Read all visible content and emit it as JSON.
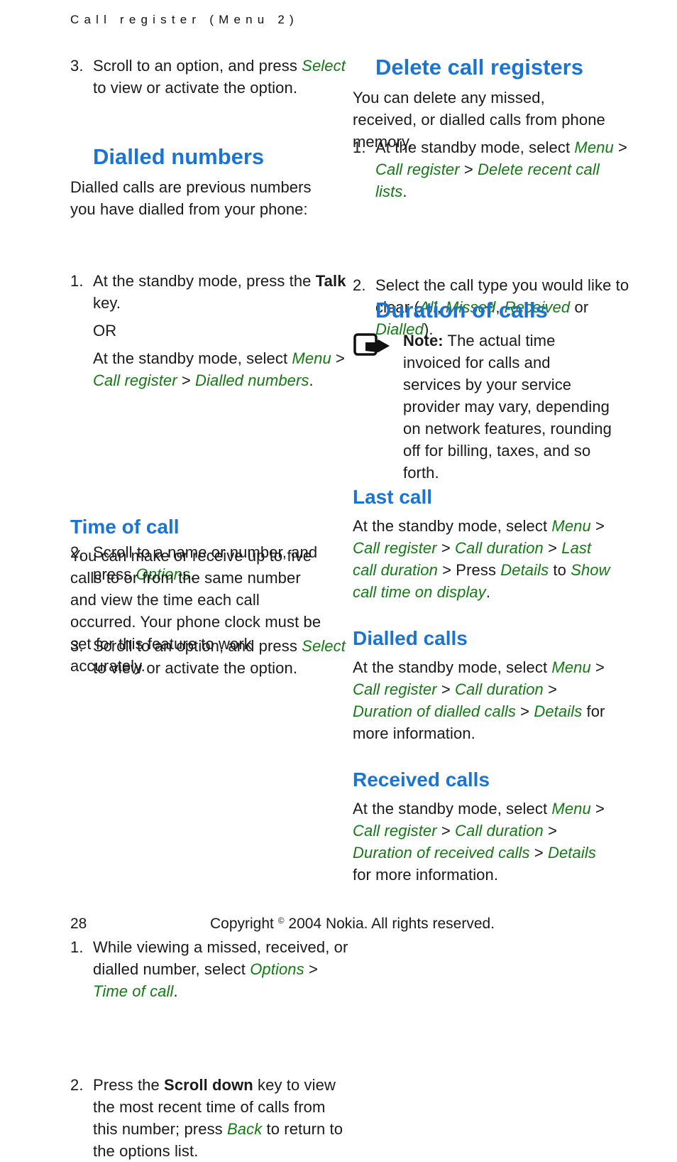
{
  "running_head": "Call register (Menu 2)",
  "left": {
    "step3_top": {
      "num": "3.",
      "pre": "Scroll to an option, and press ",
      "g1": "Select",
      "post": " to view or activate the option."
    },
    "dialled_numbers": {
      "heading": "Dialled numbers",
      "intro": "Dialled calls are previous numbers you have dialled from your phone:",
      "step1": {
        "num": "1.",
        "pre": "At the standby mode, press the ",
        "bold": "Talk",
        "post": " key."
      },
      "or": "OR",
      "alt": {
        "pre": "At the standby mode, select ",
        "g1": "Menu",
        "sep1": " > ",
        "g2": "Call register",
        "sep2": " > ",
        "g3": "Dialled numbers",
        "post": "."
      },
      "step2": {
        "num": "2.",
        "pre": "Scroll to a name or number, and press ",
        "g1": "Options",
        "post": "."
      },
      "step3": {
        "num": "3.",
        "pre": "Scroll to an option, and press ",
        "g1": "Select",
        "post": " to view or activate the option."
      }
    },
    "time_of_call": {
      "heading": "Time of call",
      "intro": "You can make or receive up to five calls to or from the same number and view the time each call occurred. Your phone clock must be set for this feature to work accurately.",
      "step1": {
        "num": "1.",
        "pre": "While viewing a missed, received, or dialled number, select ",
        "g1": "Options",
        "sep1": " > ",
        "g2": "Time of call",
        "post": "."
      },
      "step2": {
        "num": "2.",
        "pre": "Press the ",
        "bold": "Scroll down",
        "mid": " key to view the most recent time of calls from this number; press ",
        "g1": "Back",
        "post": " to return to the options list."
      }
    }
  },
  "right": {
    "delete": {
      "heading": "Delete call registers",
      "intro": "You can delete any missed, received, or dialled calls from phone memory.",
      "step1": {
        "num": "1.",
        "pre": "At the standby mode, select ",
        "g1": "Menu",
        "sep1": " > ",
        "g2": "Call register",
        "sep2": " > ",
        "g3": "Delete recent call lists",
        "post": "."
      },
      "step2": {
        "num": "2.",
        "pre": "Select the call type you would like to clear (",
        "g1": "All",
        "s1": ", ",
        "g2": "Missed",
        "s2": ", ",
        "g3": "Received",
        "s3": " or ",
        "g4": "Dialled",
        "post": ")."
      }
    },
    "duration": {
      "heading": "Duration of calls",
      "note_label": "Note:",
      "note_text": " The actual time invoiced for calls and services by your service provider may vary, depending on network features, rounding off for billing, taxes, and so forth."
    },
    "last_call": {
      "heading": "Last call",
      "pre": "At the standby mode, select ",
      "g1": "Menu",
      "sep1": " > ",
      "g2": "Call register",
      "sep2": " > ",
      "g3": "Call duration",
      "sep3": " > ",
      "g4": "Last call duration",
      "sep4": " > Press ",
      "g5": "Details",
      "sep5": " to ",
      "g6": "Show call time on display",
      "post": "."
    },
    "dialled_calls": {
      "heading": "Dialled calls",
      "pre": "At the standby mode, select ",
      "g1": "Menu",
      "sep1": " > ",
      "g2": "Call register",
      "sep2": " > ",
      "g3": "Call duration",
      "sep3": " > ",
      "g4": "Duration of dialled calls",
      "sep4": " > ",
      "g5": "Details",
      "post": " for more information."
    },
    "received_calls": {
      "heading": "Received calls",
      "pre": "At the standby mode, select ",
      "g1": "Menu",
      "sep1": " > ",
      "g2": "Call register",
      "sep2": " > ",
      "g3": "Call duration",
      "sep3": " > ",
      "g4": "Duration of received calls",
      "sep4": " > ",
      "g5": "Details",
      "post": " for more information."
    }
  },
  "footer": {
    "page_number": "28",
    "copyright_pre": "Copyright ",
    "copyright_symbol": "©",
    "copyright_post": " 2004 Nokia. All rights reserved."
  }
}
